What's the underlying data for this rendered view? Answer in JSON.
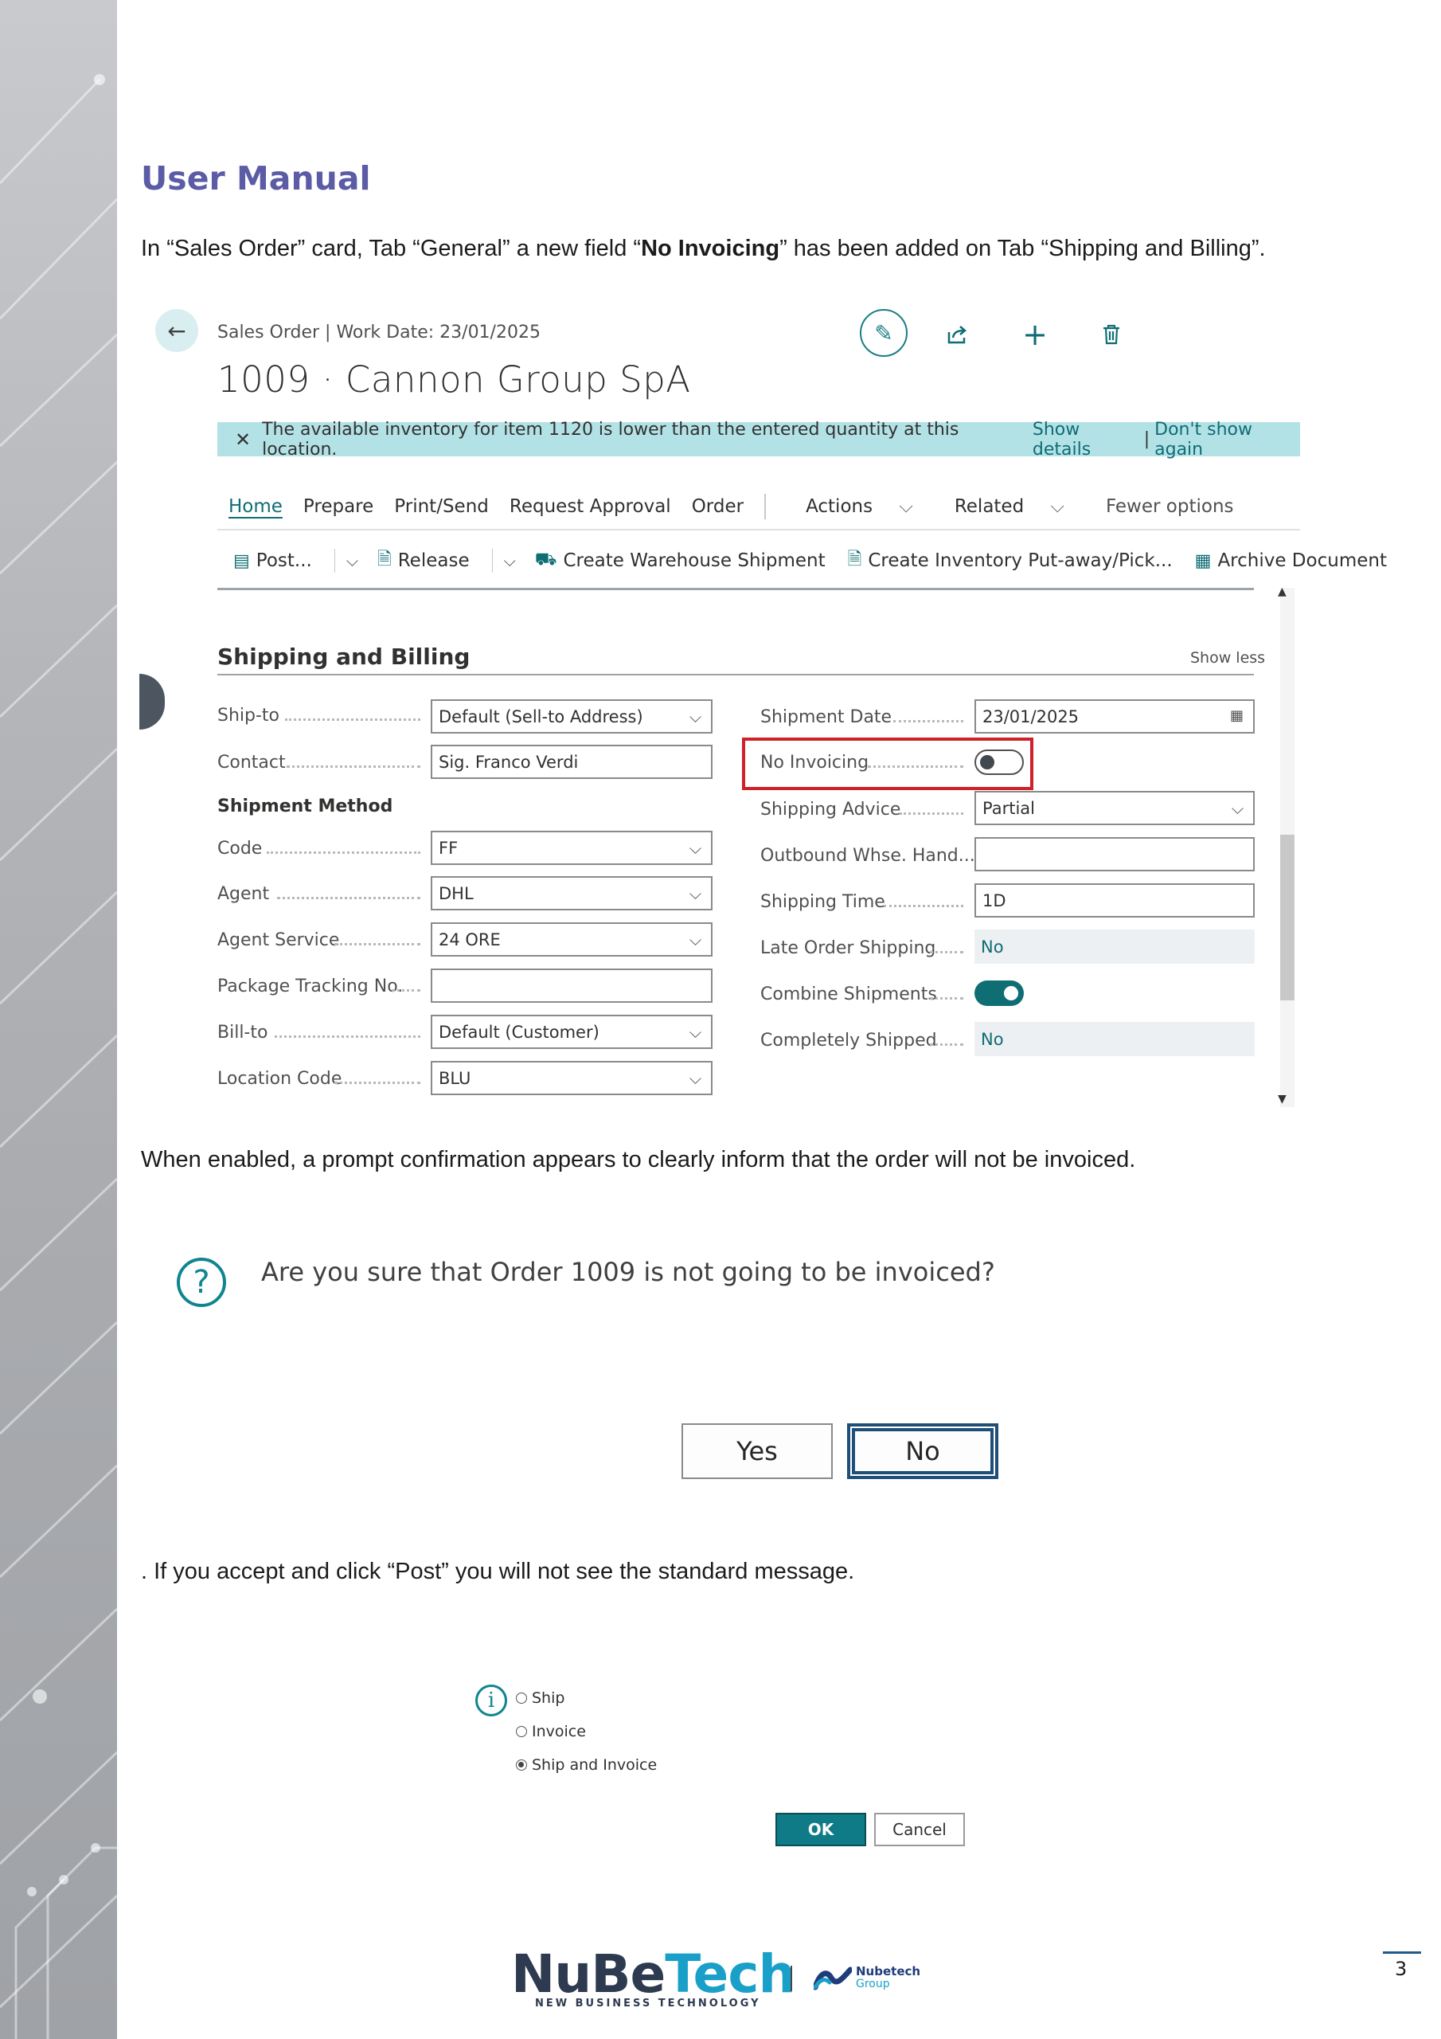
{
  "document": {
    "title": "User Manual",
    "intro": {
      "before": "In “Sales Order” card, Tab “General” a new field “",
      "bold": "No Invoicing",
      "after": "” has been added on Tab “Shipping and Billing”."
    },
    "para_prompt": "When enabled, a prompt confirmation appears to clearly inform that the order will not be invoiced.",
    "para_post": ". If you accept and click “Post” you will not see the standard message.",
    "page_number": "3"
  },
  "sales_order": {
    "breadcrumb": "Sales Order | Work Date: 23/01/2025",
    "title": "1009 · Cannon Group SpA",
    "notification": {
      "text": "The available inventory for item 1120 is lower than the entered quantity at this location.",
      "show_details": "Show details",
      "separator": "|",
      "dont_show": "Don't show again"
    },
    "tabs": [
      "Home",
      "Prepare",
      "Print/Send",
      "Request Approval",
      "Order"
    ],
    "menus": [
      "Actions",
      "Related",
      "Fewer options"
    ],
    "actions": {
      "post": "Post...",
      "release": "Release",
      "create_warehouse_shipment": "Create Warehouse Shipment",
      "create_inventory": "Create Inventory Put-away/Pick...",
      "archive": "Archive Document"
    },
    "section_title": "Shipping and Billing",
    "show_less": "Show less",
    "left_fields": {
      "ship_to": {
        "label": "Ship-to",
        "value": "Default (Sell-to Address)"
      },
      "contact": {
        "label": "Contact",
        "value": "Sig. Franco Verdi"
      },
      "shipment_method_header": "Shipment Method",
      "code": {
        "label": "Code",
        "value": "FF"
      },
      "agent": {
        "label": "Agent",
        "value": "DHL"
      },
      "agent_service": {
        "label": "Agent Service",
        "value": "24 ORE"
      },
      "package_tracking": {
        "label": "Package Tracking No.",
        "value": ""
      },
      "bill_to": {
        "label": "Bill-to",
        "value": "Default (Customer)"
      },
      "location_code": {
        "label": "Location Code",
        "value": "BLU"
      }
    },
    "right_fields": {
      "shipment_date": {
        "label": "Shipment Date",
        "value": "23/01/2025"
      },
      "no_invoicing": {
        "label": "No Invoicing",
        "value": false
      },
      "shipping_advice": {
        "label": "Shipping Advice",
        "value": "Partial"
      },
      "outbound_whse": {
        "label": "Outbound Whse. Hand...",
        "value": ""
      },
      "shipping_time": {
        "label": "Shipping Time",
        "value": "1D"
      },
      "late_order_shipping": {
        "label": "Late Order Shipping",
        "value": "No"
      },
      "combine_shipments": {
        "label": "Combine Shipments",
        "value": true
      },
      "completely_shipped": {
        "label": "Completely Shipped",
        "value": "No"
      }
    }
  },
  "confirm_dialog": {
    "question": "Are you sure that Order 1009 is not going to be invoiced?",
    "yes": "Yes",
    "no": "No"
  },
  "post_dialog": {
    "options": [
      "Ship",
      "Invoice",
      "Ship and Invoice"
    ],
    "selected": "Ship and Invoice",
    "ok": "OK",
    "cancel": "Cancel"
  },
  "footer": {
    "logo_part1": "NuBe",
    "logo_part2": "Tech",
    "logo_tagline": "NEW BUSINESS TECHNOLOGY",
    "group_name": "Nubetech",
    "group_sub": "Group"
  },
  "colors": {
    "title_purple": "#5b5ba6",
    "bc_teal": "#0f6d74",
    "notification_bg": "#b3e2e6",
    "highlight_red": "#d0202a"
  }
}
